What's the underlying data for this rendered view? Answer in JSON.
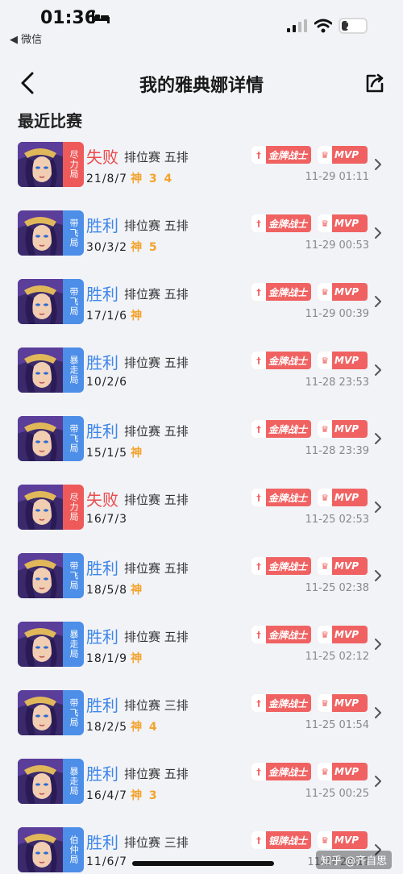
{
  "status_bar": {
    "time": "01:36",
    "back_app": "◀ 微信",
    "battery": "28",
    "battery_percent": 28
  },
  "nav": {
    "title": "我的雅典娜详情"
  },
  "section_title": "最近比赛",
  "badges": {
    "gold": "金牌战士",
    "silver": "银牌战士",
    "mvp": "MVP"
  },
  "colors": {
    "win": "#3d86ea",
    "lose": "#ea4a4a",
    "god": "#f3a32c",
    "badge": "#f06262",
    "tag_red": "#ee5a5a",
    "tag_blue": "#4c8ee8"
  },
  "matches": [
    {
      "tag": "尽力局",
      "tag_color": "red",
      "result": "失败",
      "outcome": "lose",
      "mode": "排位赛 五排",
      "kda": "21/8/7",
      "god": "神 3 4",
      "title_badge": "金牌战士",
      "mvp": "MVP",
      "datetime": "11-29 01:11"
    },
    {
      "tag": "带飞局",
      "tag_color": "blue",
      "result": "胜利",
      "outcome": "win",
      "mode": "排位赛 五排",
      "kda": "30/3/2",
      "god": "神 5",
      "title_badge": "金牌战士",
      "mvp": "MVP",
      "datetime": "11-29 00:53"
    },
    {
      "tag": "带飞局",
      "tag_color": "blue",
      "result": "胜利",
      "outcome": "win",
      "mode": "排位赛 五排",
      "kda": "17/1/6",
      "god": "神",
      "title_badge": "金牌战士",
      "mvp": "MVP",
      "datetime": "11-29 00:39"
    },
    {
      "tag": "暴走局",
      "tag_color": "blue",
      "result": "胜利",
      "outcome": "win",
      "mode": "排位赛 五排",
      "kda": "10/2/6",
      "god": "",
      "title_badge": "金牌战士",
      "mvp": "MVP",
      "datetime": "11-28 23:53"
    },
    {
      "tag": "带飞局",
      "tag_color": "blue",
      "result": "胜利",
      "outcome": "win",
      "mode": "排位赛 五排",
      "kda": "15/1/5",
      "god": "神",
      "title_badge": "金牌战士",
      "mvp": "MVP",
      "datetime": "11-28 23:39"
    },
    {
      "tag": "尽力局",
      "tag_color": "red",
      "result": "失败",
      "outcome": "lose",
      "mode": "排位赛 五排",
      "kda": "16/7/3",
      "god": "",
      "title_badge": "金牌战士",
      "mvp": "MVP",
      "datetime": "11-25 02:53"
    },
    {
      "tag": "带飞局",
      "tag_color": "blue",
      "result": "胜利",
      "outcome": "win",
      "mode": "排位赛 五排",
      "kda": "18/5/8",
      "god": "神",
      "title_badge": "金牌战士",
      "mvp": "MVP",
      "datetime": "11-25 02:38"
    },
    {
      "tag": "暴走局",
      "tag_color": "blue",
      "result": "胜利",
      "outcome": "win",
      "mode": "排位赛 五排",
      "kda": "18/1/9",
      "god": "神",
      "title_badge": "金牌战士",
      "mvp": "MVP",
      "datetime": "11-25 02:12"
    },
    {
      "tag": "带飞局",
      "tag_color": "blue",
      "result": "胜利",
      "outcome": "win",
      "mode": "排位赛 三排",
      "kda": "18/2/5",
      "god": "神 4",
      "title_badge": "金牌战士",
      "mvp": "MVP",
      "datetime": "11-25 01:54"
    },
    {
      "tag": "暴走局",
      "tag_color": "blue",
      "result": "胜利",
      "outcome": "win",
      "mode": "排位赛 五排",
      "kda": "16/4/7",
      "god": "神 3",
      "title_badge": "金牌战士",
      "mvp": "MVP",
      "datetime": "11-25 00:25"
    },
    {
      "tag": "伯仲局",
      "tag_color": "blue",
      "result": "胜利",
      "outcome": "win",
      "mode": "排位赛 三排",
      "kda": "11/6/7",
      "god": "",
      "title_badge": "银牌战士",
      "mvp": "MVP",
      "datetime": "11-2? 23:1?"
    }
  ],
  "watermark": "知乎 @齐自思"
}
